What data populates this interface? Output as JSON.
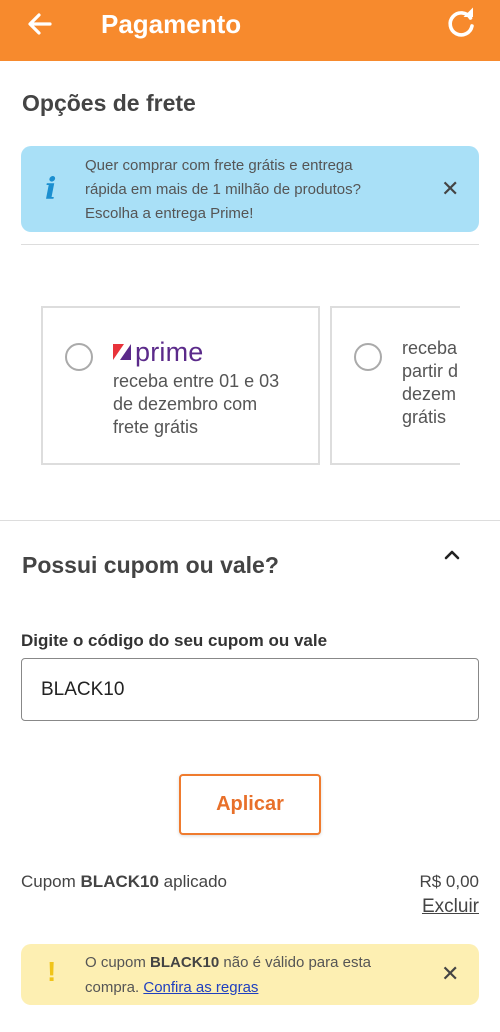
{
  "header": {
    "title": "Pagamento"
  },
  "shipping": {
    "section_title": "Opções de frete",
    "info_line1": "Quer comprar com frete grátis e entrega",
    "info_line2": "rápida em mais de 1 milhão de produtos?",
    "info_line3": "Escolha a entrega Prime!",
    "option_prime": {
      "brand": "prime",
      "line1": "receba entre 01 e 03",
      "line2": "de dezembro com",
      "line3": "frete grátis"
    },
    "option_standard": {
      "line1": "receba",
      "line2": "partir d",
      "line3": "dezem",
      "line4": "grátis"
    }
  },
  "coupon": {
    "section_title": "Possui cupom ou vale?",
    "input_label": "Digite o código do seu cupom ou vale",
    "input_value": "BLACK10",
    "apply_label": "Aplicar",
    "applied_prefix": "Cupom ",
    "applied_code": "BLACK10",
    "applied_suffix": " aplicado",
    "discount_value": "R$ 0,00",
    "remove_label": "Excluir",
    "warning_prefix": "O cupom ",
    "warning_code": "BLACK10",
    "warning_suffix": " não é válido para esta",
    "warning_line2": "compra. ",
    "warning_link": "Confira as regras"
  },
  "colors": {
    "header_bg": "#f78a2d",
    "info_bg": "#a9e0f7",
    "warning_bg": "#fdefb2",
    "accent": "#ef7b2e",
    "prime_purple": "#5b2a8a",
    "link": "#1f3fbf"
  },
  "icons": {
    "back": "arrow-left-icon",
    "refresh": "refresh-icon",
    "info": "info-icon",
    "close": "close-icon",
    "collapse": "chevron-up-icon",
    "warning": "exclamation-icon"
  }
}
